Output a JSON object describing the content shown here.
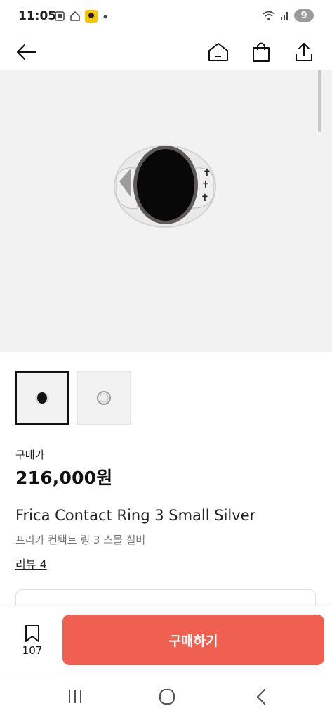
{
  "status_bar": {
    "time": "11:05",
    "battery": "9"
  },
  "product": {
    "price_label": "구매가",
    "price": "216,000원",
    "title_en": "Frica Contact Ring 3 Small Silver",
    "title_ko": "프리카 컨택트 링 3 스몰 실버",
    "reviews": "리뷰 4"
  },
  "bottom_bar": {
    "bookmark_count": "107",
    "buy_label": "구매하기"
  },
  "colors": {
    "accent": "#ef6051",
    "image_bg": "#f2f2f2"
  },
  "icons": [
    "back-arrow-icon",
    "home-icon",
    "shopping-bag-icon",
    "share-icon",
    "bookmark-icon",
    "recent-apps-icon",
    "home-circle-icon",
    "back-chevron-icon"
  ]
}
